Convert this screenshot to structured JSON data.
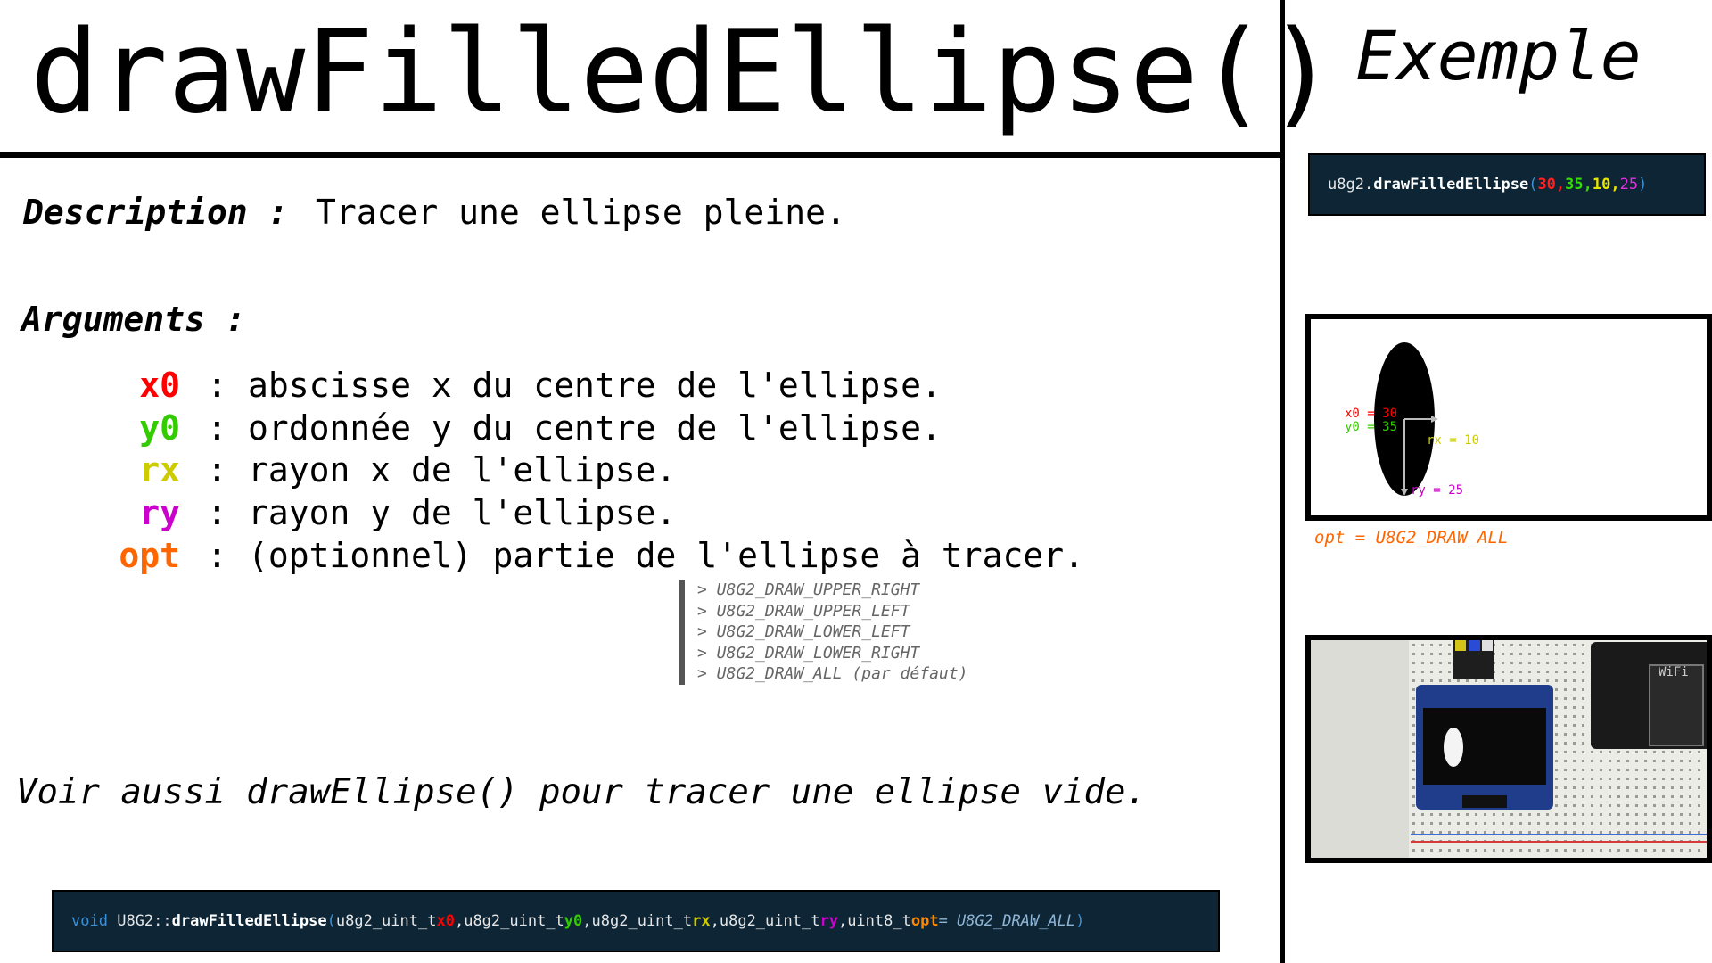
{
  "title": "drawFilledEllipse()",
  "example_title": "Exemple",
  "description": {
    "label": "Description :",
    "text": "Tracer une ellipse pleine."
  },
  "arguments": {
    "label": "Arguments :",
    "items": [
      {
        "name": "x0",
        "color": "#ff0000",
        "desc": "abscisse x du centre de l'ellipse."
      },
      {
        "name": "y0",
        "color": "#33cc00",
        "desc": "ordonnée y du centre de l'ellipse."
      },
      {
        "name": "rx",
        "color": "#cccc00",
        "desc": "rayon x de l'ellipse."
      },
      {
        "name": "ry",
        "color": "#cc00cc",
        "desc": "rayon y de l'ellipse."
      },
      {
        "name": "opt",
        "color": "#ff6600",
        "desc": "(optionnel) partie de l'ellipse à tracer."
      }
    ],
    "separator": ":"
  },
  "options": [
    "> U8G2_DRAW_UPPER_RIGHT",
    "> U8G2_DRAW_UPPER_LEFT",
    "> U8G2_DRAW_LOWER_LEFT",
    "> U8G2_DRAW_LOWER_RIGHT",
    "> U8G2_DRAW_ALL (par défaut)"
  ],
  "see_also": "Voir aussi drawEllipse() pour tracer une ellipse vide.",
  "signature": {
    "void": "void",
    "cls": "U8G2::",
    "fn": "drawFilledEllipse",
    "open": "(",
    "t1": "u8g2_uint_t ",
    "a1": "x0",
    "s1": " , ",
    "t2": "u8g2_uint_t ",
    "a2": "y0",
    "s2": " , ",
    "t3": "u8g2_uint_t ",
    "a3": "rx",
    "s3": " , ",
    "t4": "u8g2_uint_t ",
    "a4": "ry",
    "s4": " , ",
    "t5": "uint8_t ",
    "a5": "opt",
    "eq": " = U8G2_DRAW_ALL",
    "close": ")"
  },
  "example_code": {
    "obj": "u8g2.",
    "fn": "drawFilledEllipse",
    "open": "( ",
    "v1": "30,",
    "v2": " 35,",
    "v3": " 10,",
    "v4": " 25",
    "close": " )"
  },
  "preview": {
    "x0_label": "x0 = 30",
    "y0_label": "y0 = 35",
    "rx_label": "rx = 10",
    "ry_label": "ry = 25"
  },
  "opt_note": "opt = U8G2_DRAW_ALL",
  "colors": {
    "x0": "#ff0000",
    "y0": "#33cc00",
    "rx": "#cccc00",
    "ry": "#cc00cc",
    "opt": "#ff6600",
    "code_bg": "#0d2535",
    "keyword": "#3b8fd6"
  }
}
